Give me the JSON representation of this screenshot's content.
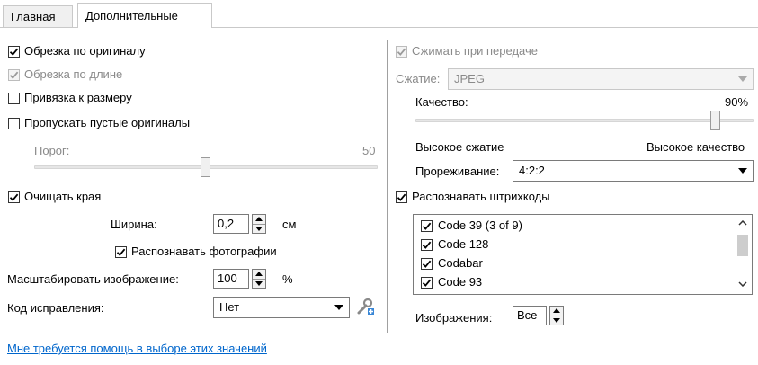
{
  "tabs": [
    {
      "label": "Главная",
      "active": false
    },
    {
      "label": "Дополнительные",
      "active": true
    }
  ],
  "left": {
    "crop_to_original": {
      "label": "Обрезка по оригиналу",
      "checked": true,
      "enabled": true
    },
    "crop_by_length": {
      "label": "Обрезка по длине",
      "checked": true,
      "enabled": false
    },
    "snap_to_size": {
      "label": "Привязка к размеру",
      "checked": false,
      "enabled": true
    },
    "skip_blank": {
      "label": "Пропускать пустые оригиналы",
      "checked": false,
      "enabled": true
    },
    "threshold": {
      "label": "Порог:",
      "value": "50",
      "level": 50
    },
    "clean_edges": {
      "label": "Очищать края",
      "checked": true
    },
    "width": {
      "label": "Ширина:",
      "value": "0,2",
      "unit": "см"
    },
    "detect_photos": {
      "label": "Распознавать фотографии",
      "checked": true
    },
    "scale": {
      "label": "Масштабировать изображение:",
      "value": "100",
      "unit": "%"
    },
    "correction": {
      "label": "Код исправления:",
      "value": "Нет"
    }
  },
  "right": {
    "compress": {
      "label": "Сжимать при передаче",
      "checked": true,
      "enabled": false
    },
    "compression": {
      "label": "Сжатие:",
      "value": "JPEG"
    },
    "quality": {
      "label": "Качество:",
      "value": "90%",
      "level": 90
    },
    "quality_low": "Высокое сжатие",
    "quality_high": "Высокое качество",
    "subsampling": {
      "label": "Прореживание:",
      "value": "4:2:2"
    },
    "barcodes": {
      "label": "Распознавать штрихкоды",
      "checked": true
    },
    "barcode_list": [
      {
        "label": "Code 39 (3 of 9)",
        "checked": true
      },
      {
        "label": "Code 128",
        "checked": true
      },
      {
        "label": "Codabar",
        "checked": true
      },
      {
        "label": "Code 93",
        "checked": true
      }
    ],
    "images": {
      "label": "Изображения:",
      "value": "Все"
    }
  },
  "help_link": "Мне требуется помощь в выборе этих значений",
  "icons": {
    "check": "checkmark-icon",
    "wrench": "wrench-plus-icon"
  },
  "colors": {
    "link": "#0066cc",
    "disabled_text": "#8a8a8a"
  }
}
